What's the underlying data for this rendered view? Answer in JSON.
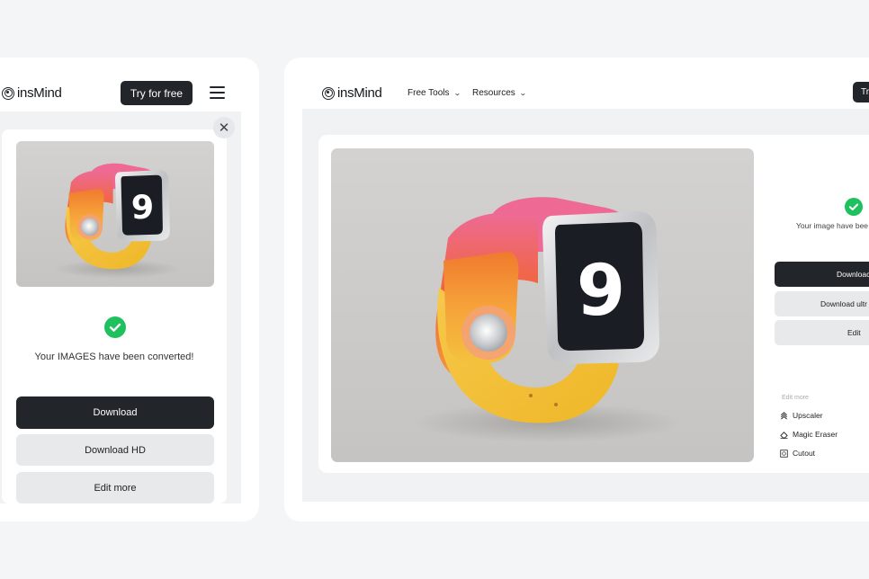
{
  "brand": {
    "name": "insMind",
    "accent_dark": "#22252a",
    "success_green": "#1fc15f"
  },
  "mobile": {
    "header": {
      "logo_text": "insMind",
      "cta_label": "Try for free",
      "menu_icon": "hamburger-icon"
    },
    "modal": {
      "close_icon": "close-icon",
      "image_alt": "Orange-pink-yellow smartwatch showing the number 9",
      "watch_face_number": "9",
      "status_icon": "check-circle-icon",
      "message": "Your IMAGES have been converted!",
      "buttons": [
        {
          "label": "Download",
          "style": "primary"
        },
        {
          "label": "Download HD",
          "style": "secondary"
        },
        {
          "label": "Edit more",
          "style": "secondary"
        }
      ]
    }
  },
  "desktop": {
    "header": {
      "logo_text": "insMind",
      "nav": [
        {
          "label": "Free Tools",
          "icon": "chevron-down-icon"
        },
        {
          "label": "Resources",
          "icon": "chevron-down-icon"
        }
      ],
      "cta_label": "Tr"
    },
    "modal": {
      "image_alt": "Orange-pink-yellow smartwatch showing the number 9",
      "watch_face_number": "9",
      "status_icon": "check-circle-icon",
      "message": "Your image have bee",
      "buttons": [
        {
          "label": "Downloac",
          "style": "primary"
        },
        {
          "label": "Download ultr",
          "style": "secondary"
        },
        {
          "label": "Edit",
          "style": "secondary"
        }
      ],
      "edit_more": {
        "heading": "Edit more",
        "tools": [
          {
            "label": "Upscaler",
            "icon": "upscaler-icon"
          },
          {
            "label": "Magic Eraser",
            "icon": "eraser-icon"
          },
          {
            "label": "Cutout",
            "icon": "cutout-icon"
          }
        ]
      }
    }
  }
}
